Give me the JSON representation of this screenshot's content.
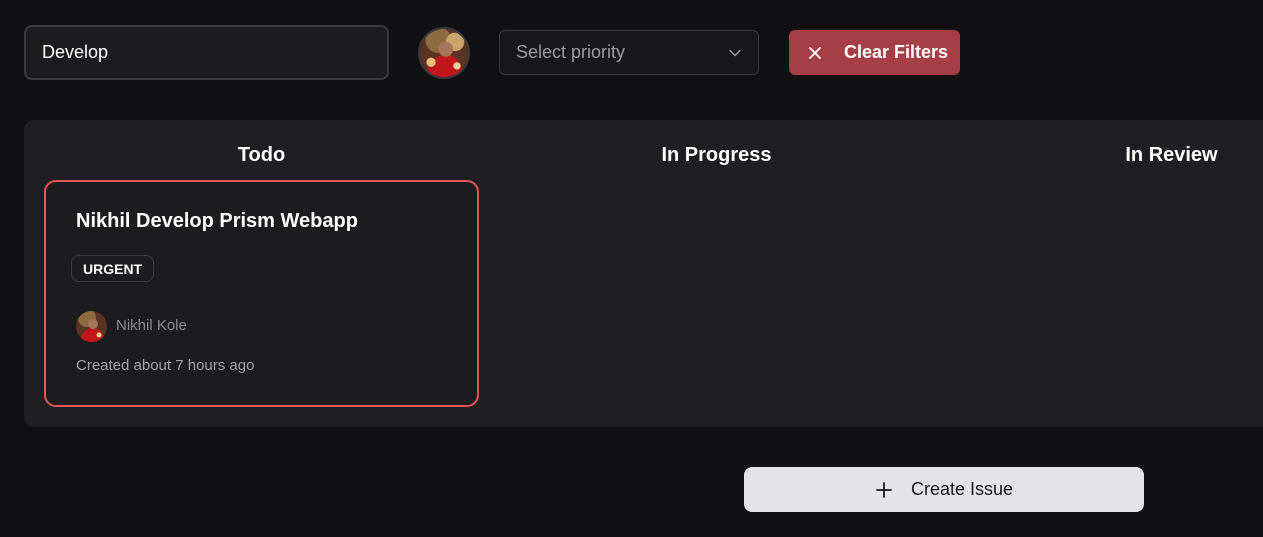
{
  "filters": {
    "search_value": "Develop",
    "priority_placeholder": "Select priority",
    "clear_label": "Clear Filters"
  },
  "board": {
    "columns": [
      {
        "title": "Todo"
      },
      {
        "title": "In Progress"
      },
      {
        "title": "In Review"
      }
    ],
    "todo_cards": [
      {
        "title": "Nikhil Develop Prism Webapp",
        "priority": "URGENT",
        "assignee": "Nikhil Kole",
        "created": "Created about 7 hours ago"
      }
    ]
  },
  "actions": {
    "create_label": "Create Issue"
  },
  "colors": {
    "background": "#111113",
    "board": "#1f1f23",
    "card_border_urgent": "#e0565b",
    "clear_button": "#a53e45",
    "create_button": "#e4e4e7"
  },
  "icons": {
    "select_icon": "chevron-down-icon",
    "clear_icon": "close-icon",
    "create_icon": "plus-icon",
    "user_avatar": "avatar"
  }
}
